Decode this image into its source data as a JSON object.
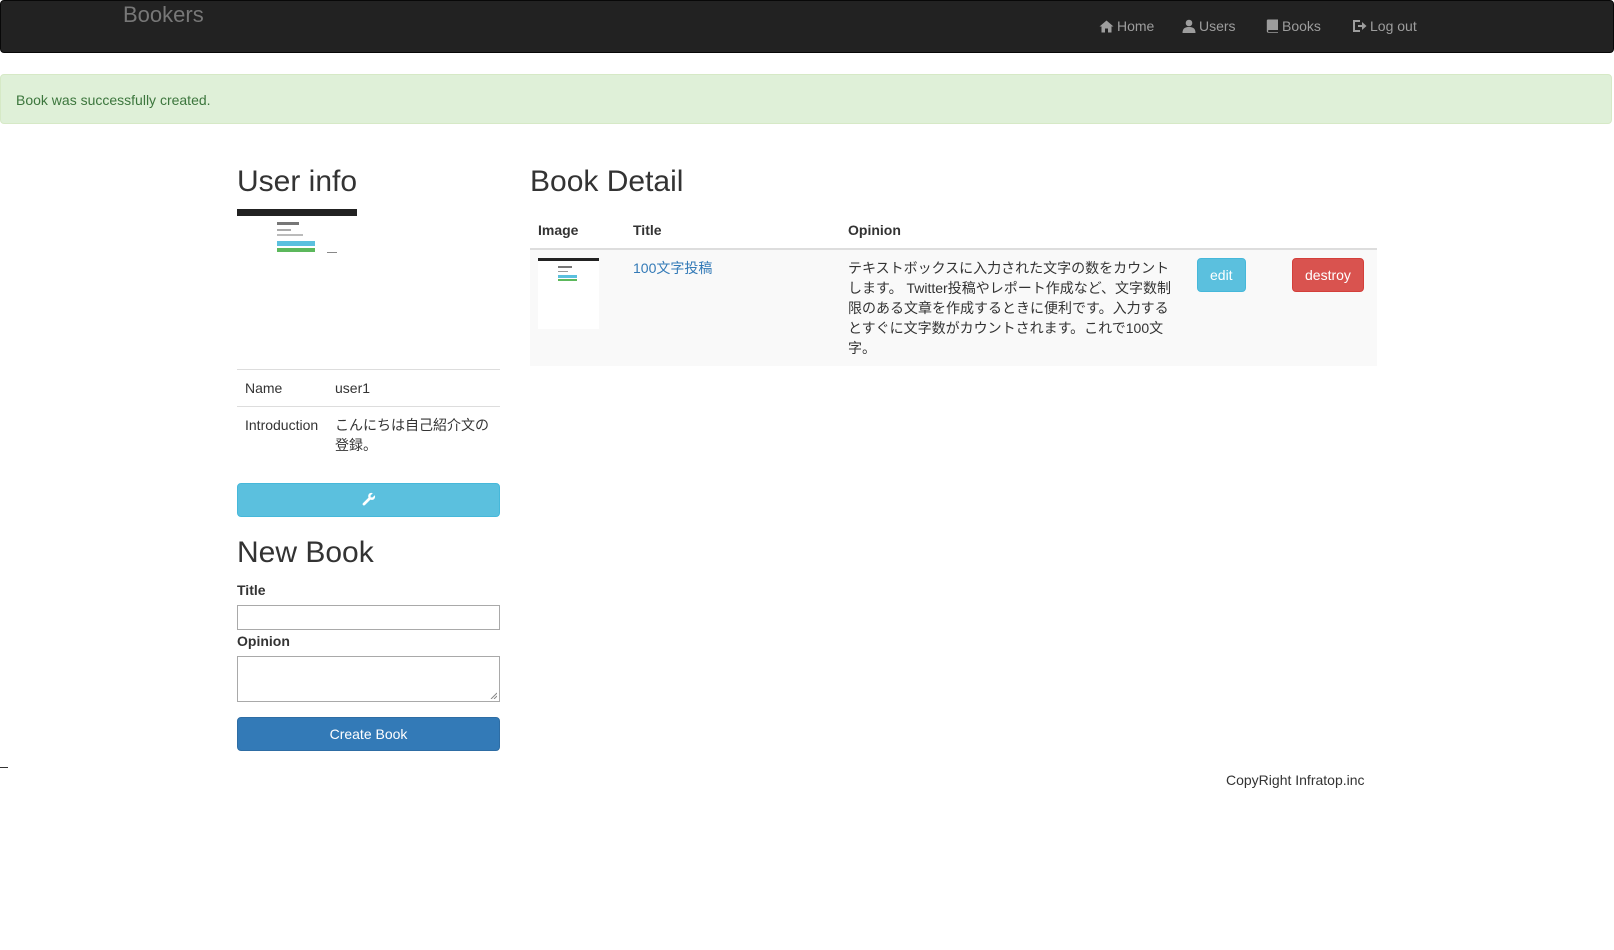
{
  "navbar": {
    "brand": "Bookers",
    "items": [
      {
        "label": "Home",
        "icon": "home-icon"
      },
      {
        "label": "Users",
        "icon": "user-icon"
      },
      {
        "label": "Books",
        "icon": "book-icon"
      },
      {
        "label": "Log out",
        "icon": "log-out-icon"
      }
    ]
  },
  "alert": {
    "message": "Book was successfully created."
  },
  "user_info": {
    "heading": "User info",
    "rows": [
      {
        "key": "Name",
        "value": "user1"
      },
      {
        "key": "Introduction",
        "value": "こんにちは自己紹介文の登録。"
      }
    ],
    "edit_icon": "wrench-icon"
  },
  "new_book": {
    "heading": "New Book",
    "title_label": "Title",
    "title_value": "",
    "opinion_label": "Opinion",
    "opinion_value": "",
    "submit_label": "Create Book"
  },
  "book_detail": {
    "heading": "Book Detail",
    "columns": [
      "Image",
      "Title",
      "Opinion"
    ],
    "book": {
      "title": "100文字投稿",
      "opinion": "テキストボックスに入力された文字の数をカウントします。 Twitter投稿やレポート作成など、文字数制限のある文章を作成するときに便利です。入力するとすぐに文字数がカウントされます。これで100文字。",
      "edit_label": "edit",
      "destroy_label": "destroy"
    }
  },
  "footer": {
    "text": "CopyRight Infratop.inc"
  },
  "colors": {
    "navbar_bg": "#222222",
    "alert_bg": "#dff0d8",
    "alert_text": "#3c763d",
    "info_button": "#5bc0de",
    "primary_button": "#337ab7",
    "danger_button": "#d9534f",
    "link": "#337ab7"
  }
}
